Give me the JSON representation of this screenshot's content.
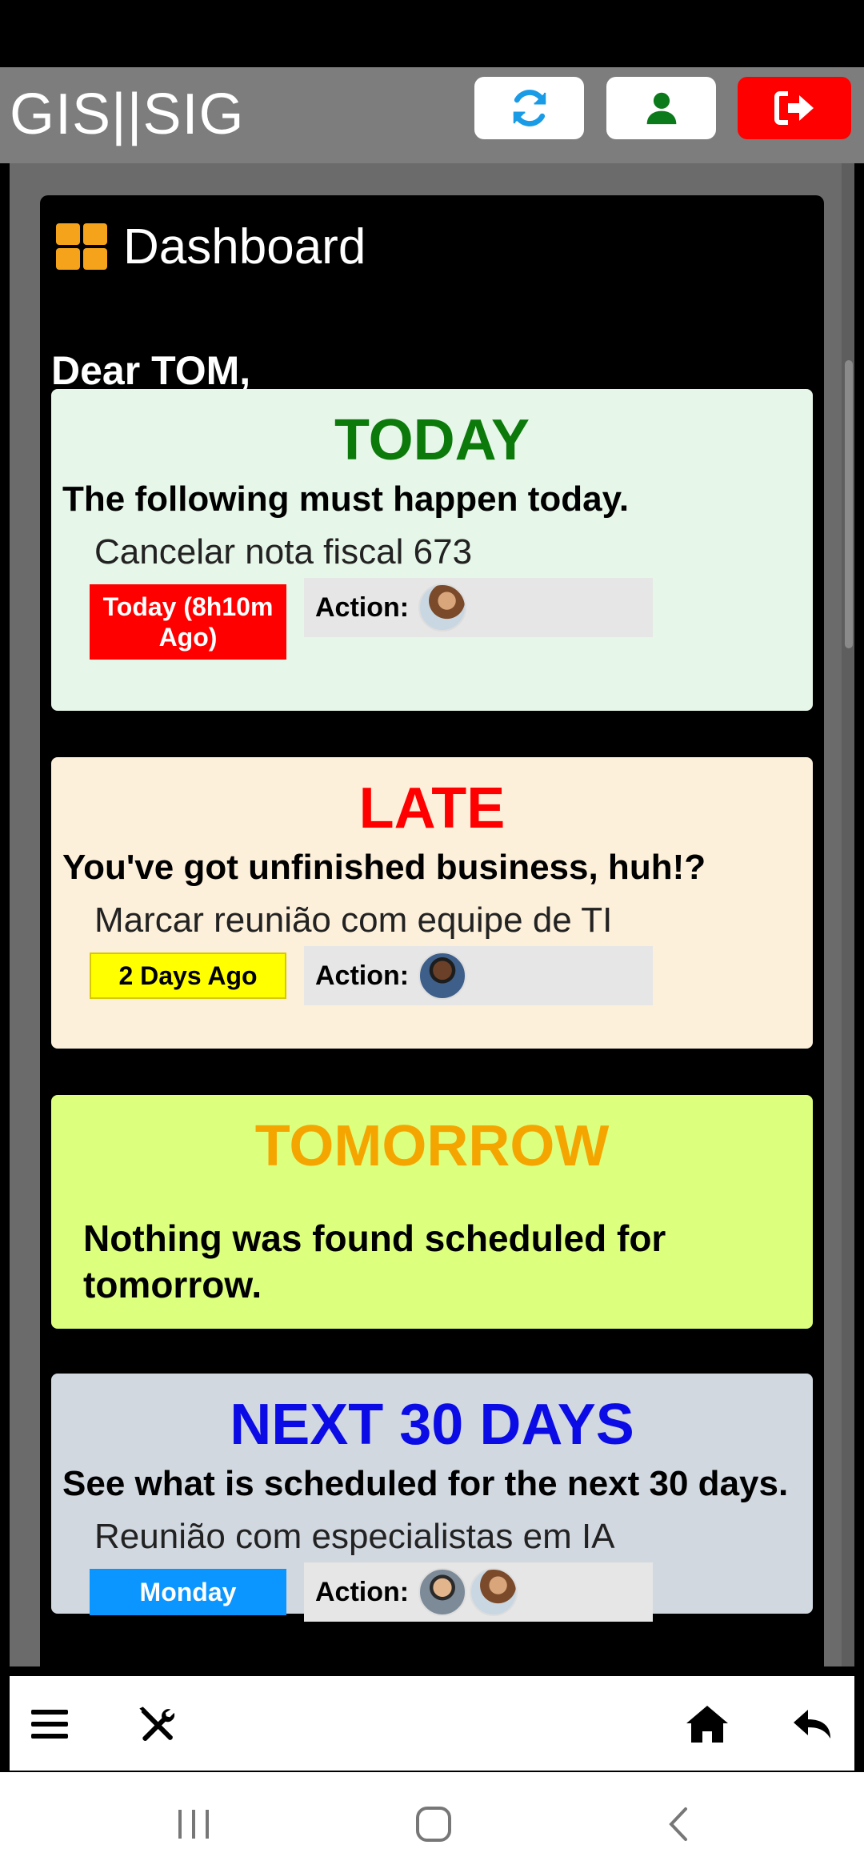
{
  "app": {
    "title": "GIS||SIG"
  },
  "header_buttons": {
    "refresh": "refresh-icon",
    "user": "user-icon",
    "logout": "logout-icon"
  },
  "dashboard": {
    "title": "Dashboard",
    "greeting": "Dear TOM,",
    "today": {
      "heading": "TODAY",
      "subtitle": "The following must happen today.",
      "item_title": "Cancelar nota fiscal 673",
      "badge": "Today (8h10m Ago)",
      "action_label": "Action:"
    },
    "late": {
      "heading": "LATE",
      "subtitle": "You've got unfinished business, huh!?",
      "item_title": "Marcar reunião com equipe de TI",
      "badge": "2 Days Ago",
      "action_label": "Action:"
    },
    "tomorrow": {
      "heading": "TOMORROW",
      "message": "Nothing was found scheduled for tomorrow."
    },
    "next30": {
      "heading": "NEXT 30 DAYS",
      "subtitle": "See what is scheduled for the next 30 days.",
      "item_title": "Reunião com especialistas em IA",
      "badge": "Monday",
      "action_label": "Action:"
    }
  },
  "colors": {
    "today_heading": "#0b7a0b",
    "late_heading": "#ff0000",
    "tomorrow_heading": "#f5a500",
    "next30_heading": "#0b0be6",
    "today_badge": "#ff0000",
    "late_badge": "#ffff00",
    "next30_badge": "#0a95ff"
  },
  "bottom_nav": [
    "menu-icon",
    "tools-icon",
    "home-icon",
    "back-icon"
  ],
  "android_nav": [
    "recents-icon",
    "home-button-icon",
    "back-arrow-icon"
  ]
}
